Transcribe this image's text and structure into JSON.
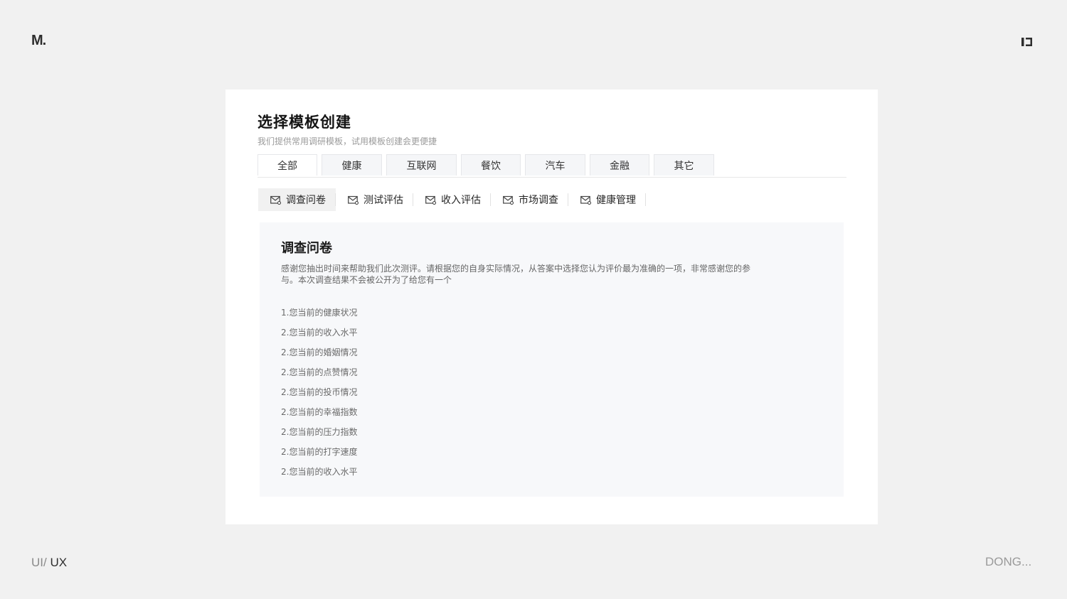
{
  "brand": {
    "logo": "M.",
    "corner_icon": "layout-panel-icon"
  },
  "footer": {
    "left_a": "UI/",
    "left_b": " UX",
    "right": "DONG..."
  },
  "card": {
    "title": "选择模板创建",
    "subtitle": "我们提供常用调研模板，试用模板创建会更便捷"
  },
  "category_tabs": [
    {
      "label": "全部",
      "active": true
    },
    {
      "label": "健康",
      "active": false
    },
    {
      "label": "互联网",
      "active": false
    },
    {
      "label": "餐饮",
      "active": false
    },
    {
      "label": "汽车",
      "active": false
    },
    {
      "label": "金融",
      "active": false
    },
    {
      "label": "其它",
      "active": false
    }
  ],
  "type_tabs": [
    {
      "label": "调查问卷",
      "icon": "mail-icon",
      "active": true
    },
    {
      "label": "测试评估",
      "icon": "mail-icon",
      "active": false
    },
    {
      "label": "收入评估",
      "icon": "mail-icon",
      "active": false
    },
    {
      "label": "市场调查",
      "icon": "mail-icon",
      "active": false
    },
    {
      "label": "健康管理",
      "icon": "mail-icon",
      "active": false
    }
  ],
  "preview": {
    "title": "调查问卷",
    "description": "感谢您抽出时间来帮助我们此次测评。请根据您的自身实际情况，从答案中选择您认为评价最为准确的一项，非常感谢您的参与。本次调查结果不会被公开为了给您有一个",
    "questions": [
      "1.您当前的健康状况",
      "2.您当前的收入水平",
      "2.您当前的婚姻情况",
      "2.您当前的点赞情况",
      "2.您当前的投币情况",
      "2.您当前的幸福指数",
      "2.您当前的压力指数",
      "2.您当前的打字速度",
      "2.您当前的收入水平"
    ]
  },
  "colors": {
    "page_bg": "#f1f1f1",
    "card_bg": "#ffffff",
    "preview_bg": "#f7f8fa"
  }
}
